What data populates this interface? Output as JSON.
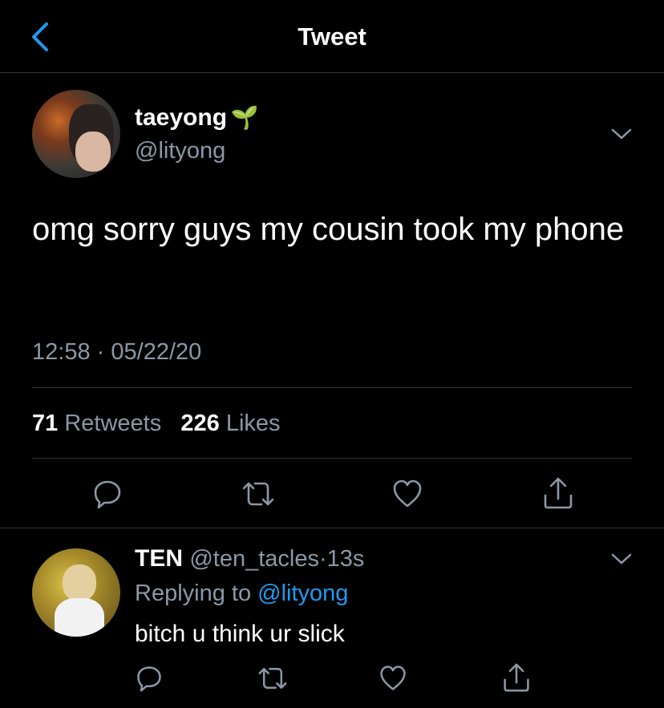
{
  "header": {
    "title": "Tweet",
    "back_icon": "chevron-left-icon",
    "accent": "#1d9bf0"
  },
  "tweet": {
    "author_name": "taeyong",
    "author_emoji": "🌱",
    "author_handle": "@lityong",
    "text": "omg sorry guys my cousin took my phone",
    "time": "12:58",
    "dot": "·",
    "date": "05/22/20",
    "retweets_count": "71",
    "retweets_label": "Retweets",
    "likes_count": "226",
    "likes_label": "Likes",
    "actions": [
      "reply-icon",
      "retweet-icon",
      "like-icon",
      "share-icon"
    ]
  },
  "reply": {
    "author_name": "TEN",
    "author_handle": "@ten_tacles",
    "dot": "·",
    "time": "13s",
    "replying_prefix": "Replying to",
    "replying_handle": "@lityong",
    "text": "bitch u think ur slick",
    "actions": [
      "reply-icon",
      "retweet-icon",
      "like-icon",
      "share-icon"
    ]
  }
}
